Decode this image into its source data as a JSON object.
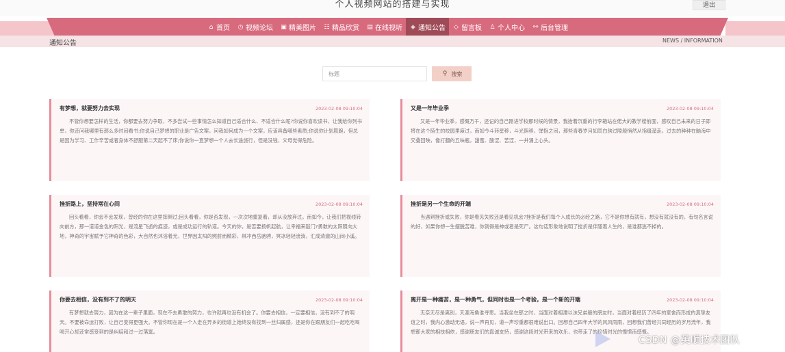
{
  "site": {
    "title": "个人视频网站的搭建与实现",
    "logout_label": "退出"
  },
  "nav": {
    "items": [
      {
        "label": "首页",
        "icon": "home-icon",
        "glyph": "⌂"
      },
      {
        "label": "视频论坛",
        "icon": "forum-icon",
        "glyph": "◷"
      },
      {
        "label": "精美图片",
        "icon": "image-icon",
        "glyph": "▣"
      },
      {
        "label": "精品欣赏",
        "icon": "appreciate-icon",
        "glyph": "☷"
      },
      {
        "label": "在线视听",
        "icon": "media-icon",
        "glyph": "▤"
      },
      {
        "label": "通知公告",
        "icon": "notice-icon",
        "glyph": "◈"
      },
      {
        "label": "留言板",
        "icon": "message-icon",
        "glyph": "◇"
      },
      {
        "label": "个人中心",
        "icon": "user-icon",
        "glyph": "♙"
      },
      {
        "label": "后台管理",
        "icon": "link-icon",
        "glyph": "⚯"
      }
    ],
    "active_index": 5
  },
  "breadcrumb": {
    "left": "通知公告",
    "right": "NEWS / INFORMATION"
  },
  "search": {
    "placeholder": "标题",
    "button_label": "搜索",
    "icon": "search-icon"
  },
  "notices": [
    {
      "title": "有梦想，就要努力去实现",
      "date": "2023-02-08 09:10:04",
      "body": "不管你想要怎样的生活，你都要去努力争取，不多尝试一些事情怎么知道自己适合什么、不适合什么呢?你说你喜欢读书，让我给你列书单，你还问我哪里有那么多时间看书;你说自己梦想的职业是广告文案，问我如何成为一个文案，应该具备哪些素质;你说你计划晨跑，但总是因为学习、工作辛苦或者身体不舒服第二天起不了床;你说你一直梦想一个人去长途旅行，但是没钱，父母觉得危险。"
    },
    {
      "title": "又是一年毕业季",
      "date": "2023-02-08 09:10:04",
      "body": "又是一年毕业季，感慨万千，还记的自己刚进学校那时候的情景，我抬着沉重的行李箱站在偌大的教学楼前面，感叹自己未来的日子即将在这个陌生的校园里度过，而如今斗转星移，斗光阴移，弹指之间，那些青春岁月如同白驹过隙般悄然从指缝溜走。过去的种种在脑海中交叠回映，像打翻的五味瓶，甜蜜、酸涩、苦涩，一并涌上心头。"
    },
    {
      "title": "挫折路上，坚持常在心间",
      "date": "2023-02-08 09:10:04",
      "body": "回头看看，你会不会发现，曾经的你在这里摔倒过;回头看看，你是否发现，一次次地重复着，却从没放弃过。而如今，让我们把视线转向前方，那一道道金色的阳光，是流星飞逝的痕迹，或是成功运行的轨道。今天的你，是否要扬帆起航，让幸福来敲门?勇敢的太阳照向大地，神奇的宇宙赋予它神奇的色彩，大自然也沐浴着光，世界因太阳的照射而精彩，林冲西岳驰骋，冥冰轻轻流淌，汇成清澈的山间小溪。"
    },
    {
      "title": "挫折是另一个生命的开端",
      "date": "2023-02-08 09:10:04",
      "body": "当遇到挫折或失败，你是看见失败还是看见机会?挫折是我们每个人成长的必经之路，它不是你想有就有，想没有就没有的。有句名言说的好，如果你想一生摆脱苦难，你就得是神或者是死尸。这句话形象地说明了挫折是伴随着人生的，是谁都逃不掉的。"
    },
    {
      "title": "你要去相信，没有到不了的明天",
      "date": "2023-02-08 09:10:04",
      "body": "有梦想就去努力，因为在这一辈子里面，现在不去勇敢的努力，也许就再也没有机会了。你要去相信，一定要相信，没有到不了的明天。不要被命运打败，让自己变得更强大。不管你现在是一个人走在异乡的街道上始终没有找到一丝归属感，还是你在跟朋友们一起吃吃喝喝开心却还常感受到的是纠结和过一过落寞。"
    },
    {
      "title": "离开是一种痛苦，是一种勇气，但同时也是一个考验，是一个新的开端",
      "date": "2023-02-08 09:10:04",
      "body": "无奈无尽是离别，天涯海角谁寻思。当我坐在那之时，当面对着相濡以沫兄弟般的朋友时，当面对着经历了四年的室舍而形成的真挚友谊之时，我内心激动无语，说一声再见，道一声珍重都很难说出口。回想自己四年大学的风风雨雨，回想我们曾经共同经历的岁月流年，我想那大家的相扶相依，感谢朋友们的真诚支持，感谢这段时光带来的欢乐，也带走了的珍惜时光的憧憬而感慨。"
    }
  ],
  "watermark": "CSDN @英顺技术团队"
}
